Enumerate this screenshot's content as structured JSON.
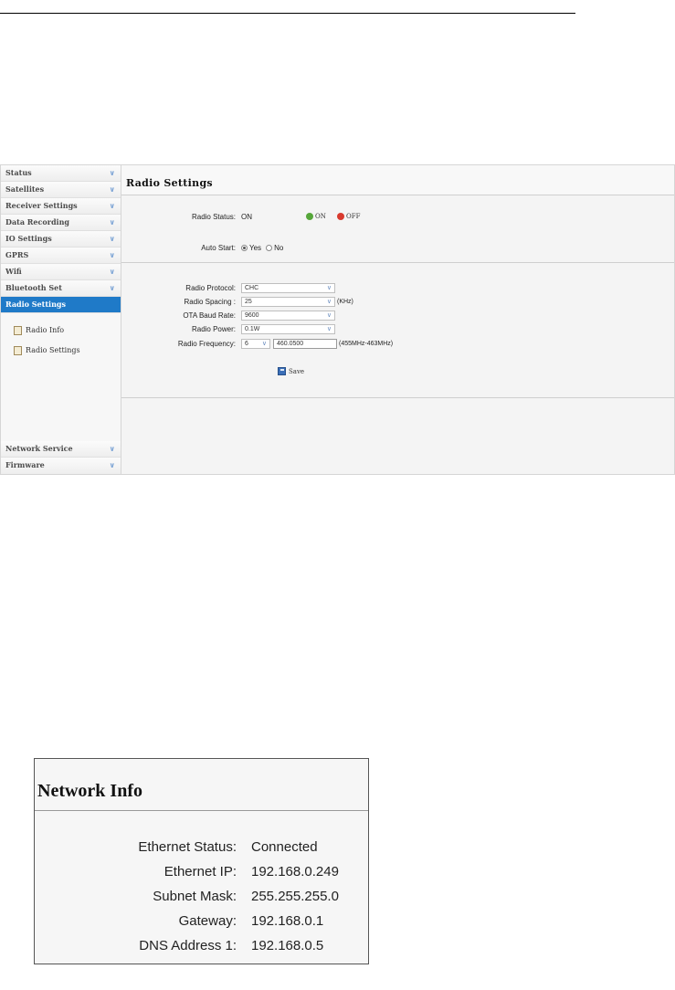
{
  "sidebar": {
    "items": [
      {
        "label": "Status"
      },
      {
        "label": "Satellites"
      },
      {
        "label": "Receiver Settings"
      },
      {
        "label": "Data Recording"
      },
      {
        "label": "IO Settings"
      },
      {
        "label": "GPRS"
      },
      {
        "label": "Wifi"
      },
      {
        "label": "Bluetooth Set"
      },
      {
        "label": "Radio Settings"
      }
    ],
    "sub_items": [
      {
        "label": "Radio Info"
      },
      {
        "label": "Radio Settings"
      }
    ],
    "bottom_items": [
      {
        "label": "Network Service"
      },
      {
        "label": "Firmware"
      }
    ],
    "chevron": "«"
  },
  "radio": {
    "title": "Radio Settings",
    "status_label": "Radio Status:",
    "status_value": "ON",
    "on_label": "ON",
    "off_label": "OFF",
    "autostart_label": "Auto Start:",
    "yes_label": "Yes",
    "no_label": "No",
    "protocol_label": "Radio Protocol:",
    "protocol_value": "CHC",
    "spacing_label": "Radio Spacing :",
    "spacing_value": "25",
    "spacing_unit": "(KHz)",
    "baud_label": "OTA Baud Rate:",
    "baud_value": "9600",
    "power_label": "Radio Power:",
    "power_value": "0.1W",
    "freq_label": "Radio Frequency:",
    "freq_channel": "6",
    "freq_value": "460.0500",
    "freq_range": "(455MHz-463MHz)",
    "save_label": "Save"
  },
  "network": {
    "title": "Network Info",
    "rows": [
      {
        "label": "Ethernet Status:",
        "value": "Connected"
      },
      {
        "label": "Ethernet IP:",
        "value": "192.168.0.249"
      },
      {
        "label": "Subnet Mask:",
        "value": "255.255.255.0"
      },
      {
        "label": "Gateway:",
        "value": "192.168.0.1"
      },
      {
        "label": "DNS Address 1:",
        "value": "192.168.0.5"
      }
    ]
  },
  "colors": {
    "active_item": "#1f7ac8",
    "on_icon": "#56a63a",
    "off_icon": "#d83a2e"
  }
}
